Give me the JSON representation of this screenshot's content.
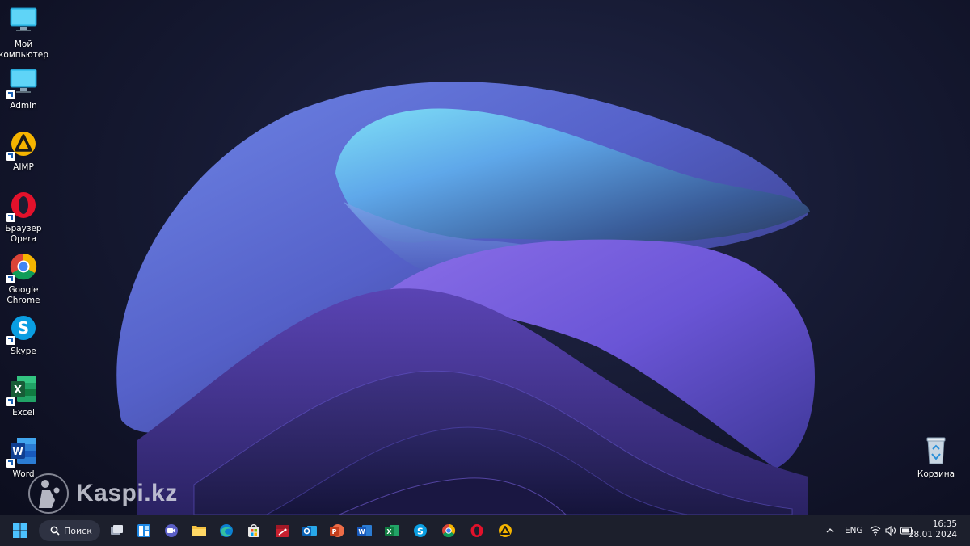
{
  "desktop": {
    "icons": [
      {
        "label": "Мой\nкомпьютер",
        "icon": "monitor-icon"
      },
      {
        "label": "Admin",
        "icon": "monitor-icon"
      },
      {
        "label": "AIMP",
        "icon": "aimp-icon"
      },
      {
        "label": "Браузер\nOpera",
        "icon": "opera-icon"
      },
      {
        "label": "Google\nChrome",
        "icon": "chrome-icon"
      },
      {
        "label": "Skype",
        "icon": "skype-icon"
      },
      {
        "label": "Excel",
        "icon": "excel-icon"
      },
      {
        "label": "Word",
        "icon": "word-icon"
      }
    ],
    "recycle_bin": {
      "label": "Корзина",
      "icon": "recycle-bin-icon"
    }
  },
  "watermark": {
    "text": "Kaspi.kz"
  },
  "taskbar": {
    "search_label": "Поиск",
    "apps": [
      "start-icon",
      "task-view-icon",
      "widgets-icon",
      "meet-icon",
      "file-explorer-icon",
      "edge-icon",
      "store-icon",
      "pdf-icon",
      "outlook-icon",
      "powerpoint-icon",
      "word-icon",
      "excel-icon",
      "skype-icon",
      "chrome-icon",
      "opera-icon",
      "aimp-icon"
    ],
    "tray": {
      "language": "ENG",
      "time": "16:35",
      "date": "28.01.2024"
    }
  },
  "colors": {
    "taskbar_bg": "#1c1f2c",
    "accent_blue": "#0078d4"
  }
}
